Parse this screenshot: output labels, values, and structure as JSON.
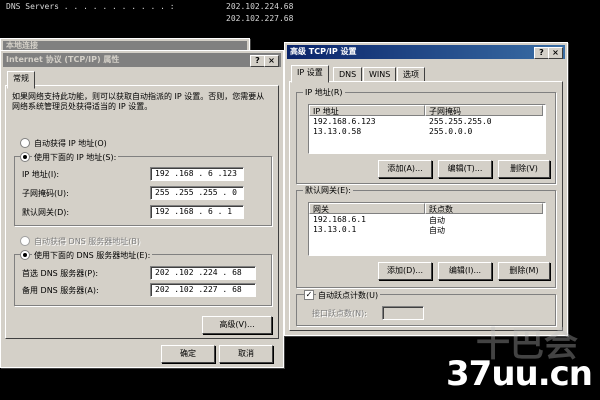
{
  "console": {
    "dns_label": "DNS Servers . . . . . . . . . . . :",
    "dns_1": "202.102.224.68",
    "dns_2": "202.102.227.68"
  },
  "bg_title": "本地连接",
  "tcpip_dialog": {
    "title": "Internet 协议 (TCP/IP) 属性",
    "help_btn": "?",
    "close_btn": "×",
    "tab_general": "常规",
    "intro": "如果网络支持此功能，则可以获取自动指派的 IP 设置。否则，您需要从网络系统管理员处获得适当的 IP 设置。",
    "auto_ip": "自动获得 IP 地址(O)",
    "manual_ip": "使用下面的 IP 地址(S):",
    "ip_label": "IP 地址(I):",
    "ip_value": "192 .168 . 6 .123",
    "mask_label": "子网掩码(U):",
    "mask_value": "255 .255 .255 . 0",
    "gw_label": "默认网关(D):",
    "gw_value": "192 .168 . 6 . 1",
    "auto_dns": "自动获得 DNS 服务器地址(B)",
    "manual_dns": "使用下面的 DNS 服务器地址(E):",
    "dns1_label": "首选 DNS 服务器(P):",
    "dns1_value": "202 .102 .224 . 68",
    "dns2_label": "备用 DNS 服务器(A):",
    "dns2_value": "202 .102 .227 . 68",
    "advanced_btn": "高级(V)...",
    "ok_btn": "确定",
    "cancel_btn": "取消"
  },
  "advanced_dialog": {
    "title": "高级 TCP/IP 设置",
    "help_btn": "?",
    "close_btn": "×",
    "tabs": [
      "IP 设置",
      "DNS",
      "WINS",
      "选项"
    ],
    "ip_group": "IP 地址(R)",
    "ip_cols": [
      "IP 地址",
      "子网掩码"
    ],
    "ip_rows": [
      [
        "192.168.6.123",
        "255.255.255.0"
      ],
      [
        "13.13.0.58",
        "255.0.0.0"
      ]
    ],
    "gw_group": "默认网关(E):",
    "gw_cols": [
      "网关",
      "跃点数"
    ],
    "gw_rows": [
      [
        "192.168.6.1",
        "自动"
      ],
      [
        "13.13.0.1",
        "自动"
      ]
    ],
    "add_btn": "添加(A)...",
    "edit_btn": "编辑(T)...",
    "delete_btn": "删除(V)",
    "add_btn2": "添加(D)...",
    "edit_btn2": "编辑(I)...",
    "delete_btn2": "删除(M)",
    "auto_metric": "自动跃点计数(U)",
    "metric_label": "接口跃点数(N):"
  },
  "watermark": {
    "site": "37uu.cn",
    "cn": "十巴会"
  }
}
